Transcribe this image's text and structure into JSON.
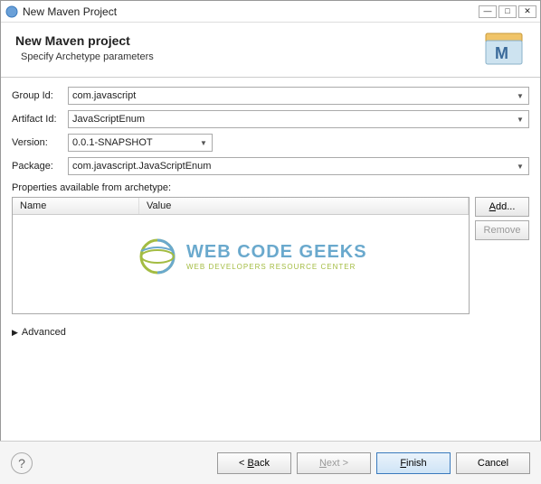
{
  "window": {
    "title": "New Maven Project"
  },
  "header": {
    "title": "New Maven project",
    "subtitle": "Specify Archetype parameters"
  },
  "fields": {
    "groupId": {
      "label": "Group Id:",
      "value": "com.javascript"
    },
    "artifactId": {
      "label": "Artifact Id:",
      "value": "JavaScriptEnum"
    },
    "version": {
      "label": "Version:",
      "value": "0.0.1-SNAPSHOT"
    },
    "package": {
      "label": "Package:",
      "value": "com.javascript.JavaScriptEnum"
    }
  },
  "properties": {
    "label": "Properties available from archetype:",
    "columns": {
      "name": "Name",
      "value": "Value"
    },
    "addBtn": "Add...",
    "removeBtn": "Remove"
  },
  "advanced": {
    "label": "Advanced"
  },
  "buttons": {
    "back": "Back",
    "next": "Next",
    "finish": "Finish",
    "cancel": "Cancel"
  },
  "watermark": {
    "line1": "WEB CODE GEEKS",
    "line2": "WEB DEVELOPERS RESOURCE CENTER"
  }
}
